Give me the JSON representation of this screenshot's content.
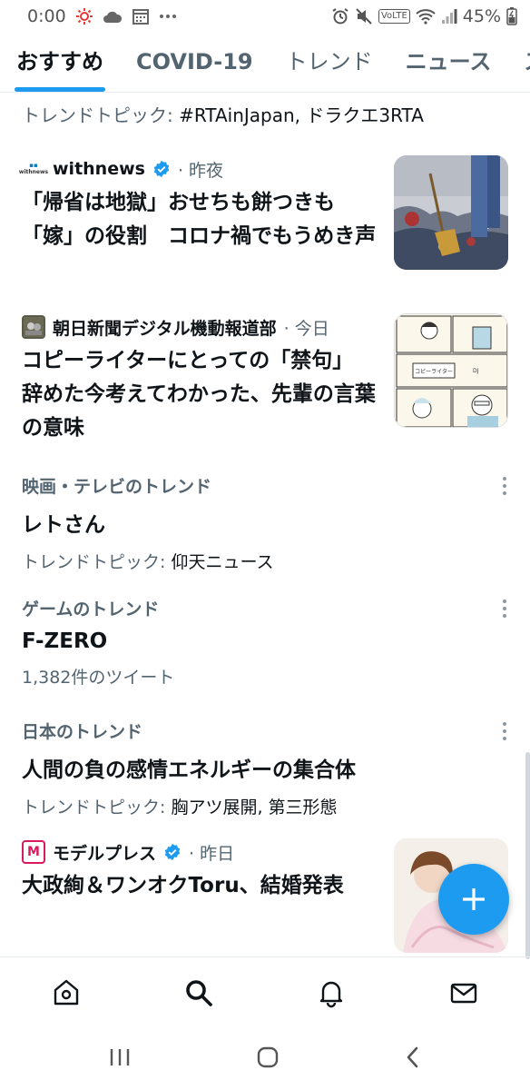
{
  "status_bar": {
    "time": "0:00",
    "battery": "45%",
    "network_tag": "VoLTE"
  },
  "tabs": [
    {
      "label": "おすすめ"
    },
    {
      "label": "COVID-19"
    },
    {
      "label": "トレンド"
    },
    {
      "label": "ニュース"
    },
    {
      "label": "スポ"
    }
  ],
  "topic_top": {
    "prefix": "トレンドトピック: ",
    "topics": "#RTAinJapan, ドラクエ3RTA"
  },
  "news": [
    {
      "source": "withnews",
      "logo_text": "withnews",
      "verified": true,
      "time": "· 昨夜",
      "headline": "「帰省は地獄」おせちも餅つきも「嫁」の役割　コロナ禍でもうめき声"
    },
    {
      "source": "朝日新聞デジタル機動報道部",
      "verified": false,
      "time": "· 今日",
      "headline": "コピーライターにとっての「禁句」　辞めた今考えてわかった、先輩の言葉の意味"
    },
    {
      "source": "モデルプレス",
      "logo_text": "M",
      "verified": true,
      "time": "· 昨日",
      "headline": "大政絢＆ワンオクToru、結婚発表"
    }
  ],
  "trends": [
    {
      "context": "映画・テレビのトレンド",
      "title": "レトさん",
      "sub_prefix": "トレンドトピック: ",
      "sub": "仰天ニュース"
    },
    {
      "context": "ゲームのトレンド",
      "title": "F-ZERO",
      "sub_prefix": "",
      "sub": "1,382件のツイート"
    },
    {
      "context": "日本のトレンド",
      "title": "人間の負の感情エネルギーの集合体",
      "sub_prefix": "トレンドトピック: ",
      "sub": "胸アツ展開, 第三形態"
    }
  ],
  "comic_text": {
    "name": "DJ",
    "caption": "コピーライター"
  },
  "icons": {
    "bottom_nav": [
      "home-icon",
      "search-icon",
      "bell-icon",
      "mail-icon"
    ],
    "system_nav": [
      "recents-icon",
      "home-circle-icon",
      "back-icon"
    ]
  },
  "colors": {
    "accent": "#1d9bf0",
    "secondary_text": "#536471"
  }
}
